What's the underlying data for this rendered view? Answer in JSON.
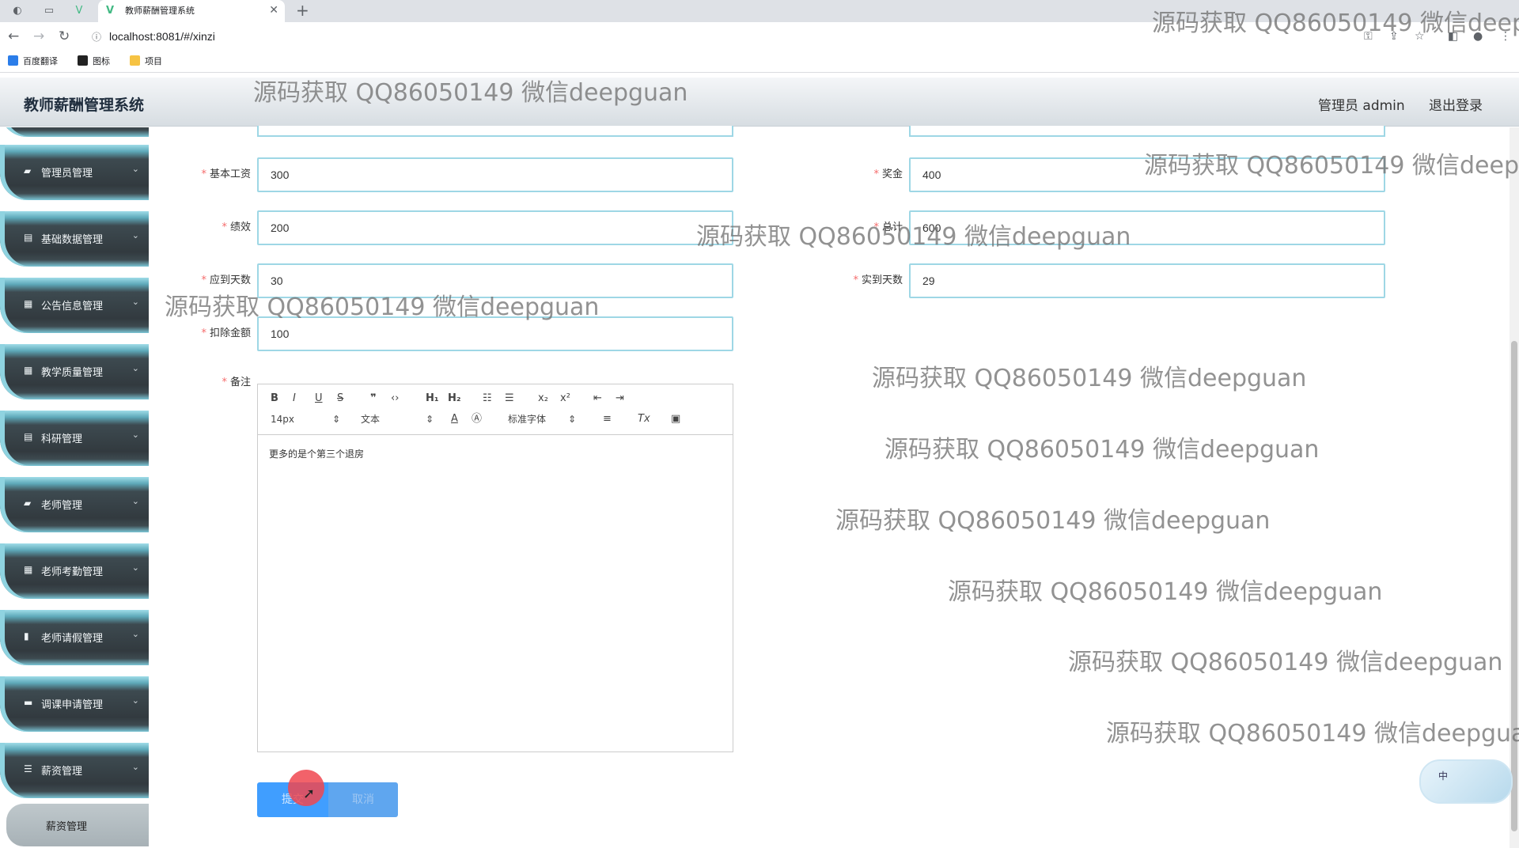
{
  "browser": {
    "tab_title": "教师薪酬管理系统",
    "url": "localhost:8081/#/xinzi",
    "bookmarks": [
      "百度翻译",
      "图标",
      "项目"
    ]
  },
  "header": {
    "title": "教师薪酬管理系统",
    "admin": "管理员 admin",
    "logout": "退出登录"
  },
  "sidebar": {
    "items": [
      {
        "label": "管理员管理",
        "icon": "user-icon"
      },
      {
        "label": "基础数据管理",
        "icon": "document-icon"
      },
      {
        "label": "公告信息管理",
        "icon": "grid-icon"
      },
      {
        "label": "教学质量管理",
        "icon": "grid-icon"
      },
      {
        "label": "科研管理",
        "icon": "document-icon"
      },
      {
        "label": "老师管理",
        "icon": "user-icon"
      },
      {
        "label": "老师考勤管理",
        "icon": "grid-icon"
      },
      {
        "label": "老师请假管理",
        "icon": "chart-icon"
      },
      {
        "label": "调课申请管理",
        "icon": "monitor-icon"
      },
      {
        "label": "薪资管理",
        "icon": "sliders-icon"
      }
    ],
    "sub_item": "薪资管理"
  },
  "form": {
    "base_salary": {
      "label": "基本工资",
      "value": "300"
    },
    "bonus": {
      "label": "奖金",
      "value": "400"
    },
    "performance": {
      "label": "绩效",
      "value": "200"
    },
    "total": {
      "label": "总计",
      "value": "600"
    },
    "expected_days": {
      "label": "应到天数",
      "value": "30"
    },
    "actual_days": {
      "label": "实到天数",
      "value": "29"
    },
    "deduction": {
      "label": "扣除金额",
      "value": "100"
    },
    "remarks": {
      "label": "备注",
      "content": "更多的是个第三个退房"
    }
  },
  "editor": {
    "font_size": "14px",
    "block_type": "文本",
    "font_family": "标准字体"
  },
  "buttons": {
    "submit": "提交",
    "cancel": "取消"
  },
  "ime": {
    "label": "中"
  },
  "watermark": "源码获取 QQ86050149 微信deepguan"
}
